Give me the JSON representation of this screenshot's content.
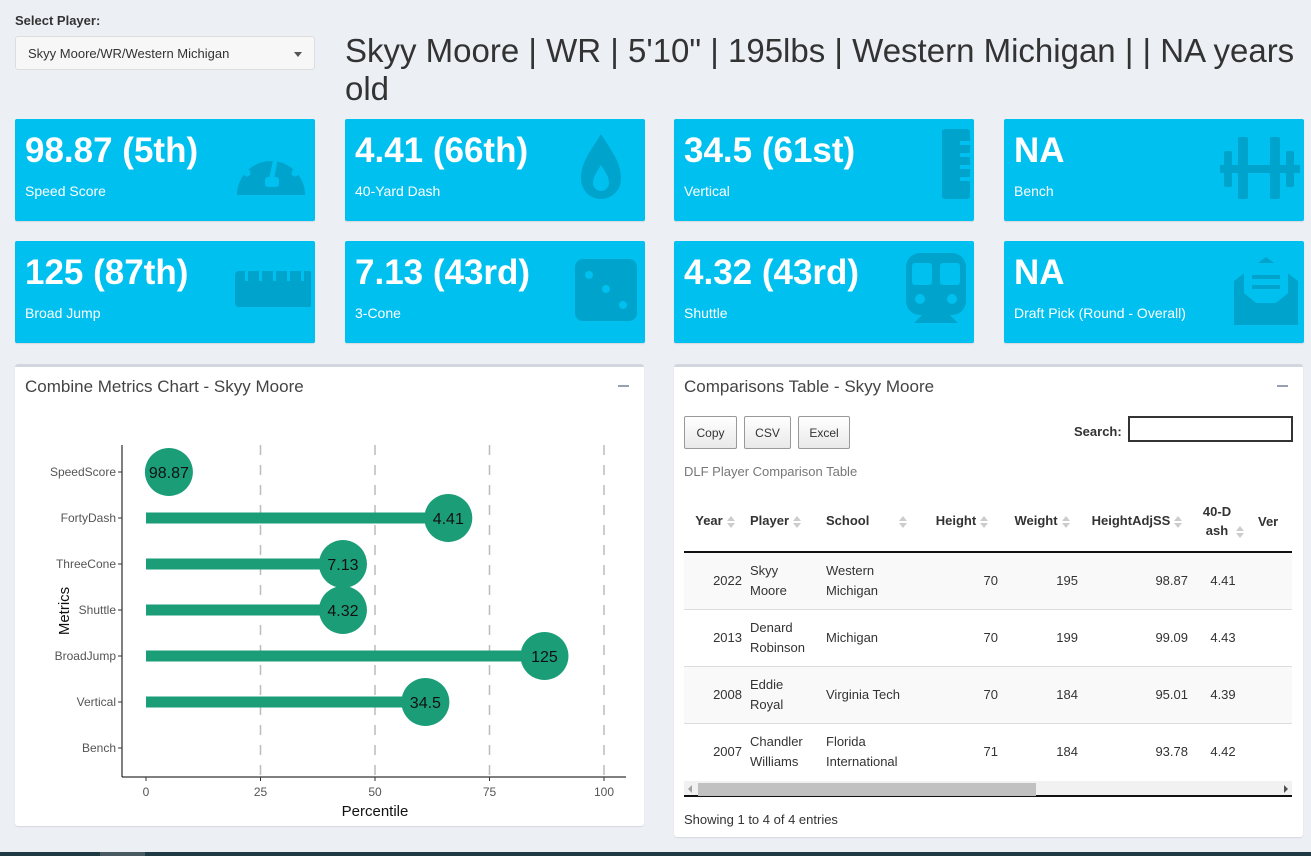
{
  "selector": {
    "label": "Select Player:",
    "selected": "Skyy Moore/WR/Western Michigan"
  },
  "player_header": "Skyy Moore | WR | 5'10\" | 195lbs | Western Michigan | | NA years old",
  "info_boxes": [
    {
      "value": "98.87 (5th)",
      "label": "Speed Score",
      "icon": "tachometer-icon"
    },
    {
      "value": "4.41 (66th)",
      "label": "40-Yard Dash",
      "icon": "tint-icon"
    },
    {
      "value": "34.5 (61st)",
      "label": "Vertical",
      "icon": "ruler-vertical-icon"
    },
    {
      "value": "NA",
      "label": "Bench",
      "icon": "dumbbell-icon"
    },
    {
      "value": "125 (87th)",
      "label": "Broad Jump",
      "icon": "ruler-horizontal-icon"
    },
    {
      "value": "7.13 (43rd)",
      "label": "3-Cone",
      "icon": "dice-three-icon"
    },
    {
      "value": "4.32 (43rd)",
      "label": "Shuttle",
      "icon": "subway-icon"
    },
    {
      "value": "NA",
      "label": "Draft Pick (Round - Overall)",
      "icon": "envelope-open-text-icon"
    }
  ],
  "colors": {
    "info_box_bg": "#00c0ef",
    "lollipop": "#1b9e77"
  },
  "chart_panel": {
    "title": "Combine Metrics Chart - Skyy Moore"
  },
  "chart_data": {
    "type": "lollipop",
    "title": "Combine Metrics Chart - Skyy Moore",
    "xlabel": "Percentile",
    "ylabel": "Metrics",
    "xlim": [
      0,
      100
    ],
    "xticks": [
      0,
      25,
      50,
      75,
      100
    ],
    "grid": "vertical dashed",
    "categories": [
      "SpeedScore",
      "FortyDash",
      "ThreeCone",
      "Shuttle",
      "BroadJump",
      "Vertical",
      "Bench"
    ],
    "percentiles": [
      5,
      66,
      43,
      43,
      87,
      61,
      null
    ],
    "labels": [
      "98.87",
      "4.41",
      "7.13",
      "4.32",
      "125",
      "34.5",
      null
    ]
  },
  "table_panel": {
    "title": "Comparisons Table - Skyy Moore",
    "buttons": [
      "Copy",
      "CSV",
      "Excel"
    ],
    "search_label": "Search:",
    "search_value": "",
    "caption": "DLF Player Comparison Table",
    "columns": [
      "Year",
      "Player",
      "School",
      "Height",
      "Weight",
      "HeightAdjSS",
      "40-Dash",
      "Ver"
    ],
    "rows": [
      [
        "2022",
        "Skyy Moore",
        "Western Michigan",
        "70",
        "195",
        "98.87",
        "4.41",
        ""
      ],
      [
        "2013",
        "Denard Robinson",
        "Michigan",
        "70",
        "199",
        "99.09",
        "4.43",
        ""
      ],
      [
        "2008",
        "Eddie Royal",
        "Virginia Tech",
        "70",
        "184",
        "95.01",
        "4.39",
        ""
      ],
      [
        "2007",
        "Chandler Williams",
        "Florida International",
        "71",
        "184",
        "93.78",
        "4.42",
        ""
      ]
    ],
    "info": "Showing 1 to 4 of 4 entries"
  }
}
